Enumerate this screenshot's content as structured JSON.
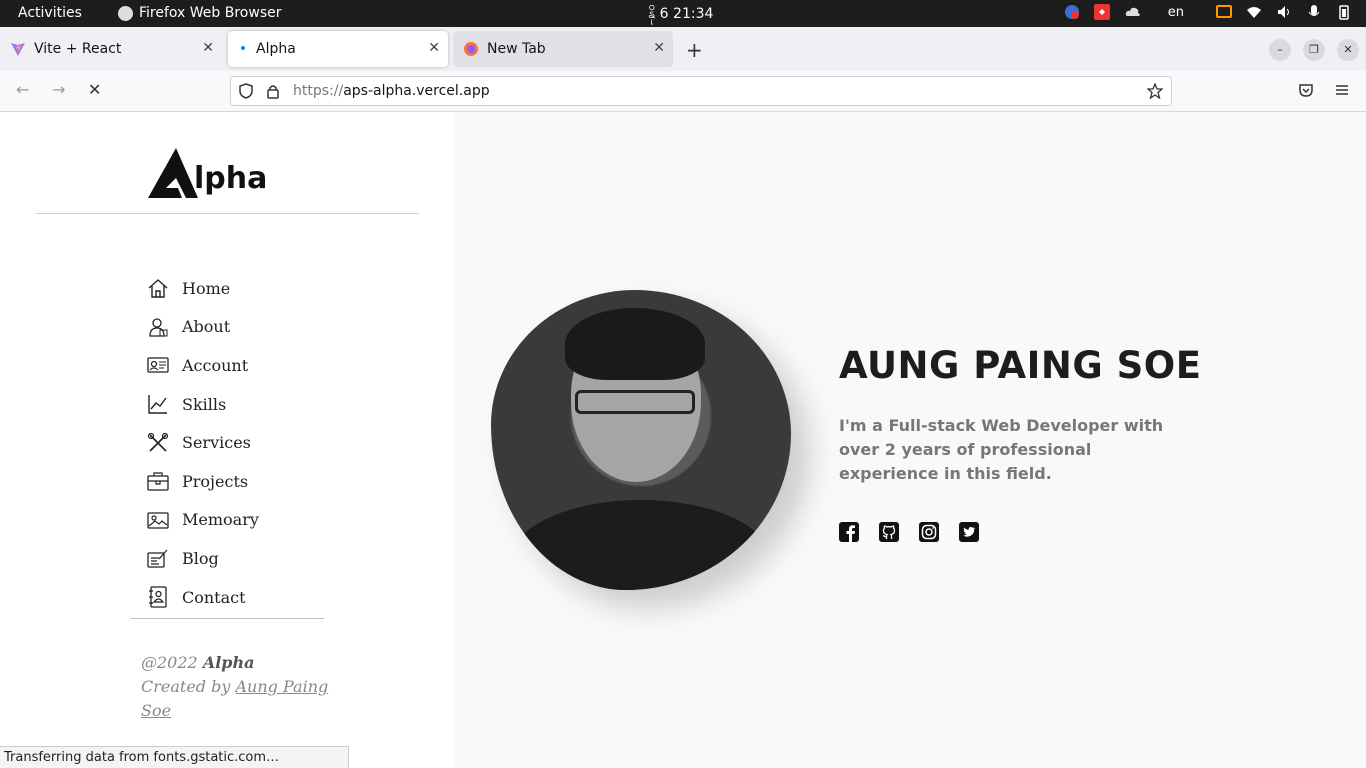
{
  "system": {
    "activities": "Activities",
    "app_name": "Firefox Web Browser",
    "clock": "နို 6  21:34",
    "lang": "en"
  },
  "tabs": [
    {
      "title": "Vite + React",
      "icon": "vite-icon"
    },
    {
      "title": "Alpha",
      "icon": "loading-dot-icon",
      "active": true
    },
    {
      "title": "New Tab",
      "icon": "firefox-icon"
    }
  ],
  "url": {
    "scheme": "https://",
    "host": "aps-alpha.vercel.app"
  },
  "sidebar": {
    "logo_text": "lpha",
    "menu": [
      {
        "label": "Home",
        "icon": "home-icon"
      },
      {
        "label": "About",
        "icon": "user-icon"
      },
      {
        "label": "Account",
        "icon": "id-card-icon"
      },
      {
        "label": "Skills",
        "icon": "chart-line-icon"
      },
      {
        "label": "Services",
        "icon": "tools-icon"
      },
      {
        "label": "Projects",
        "icon": "briefcase-icon"
      },
      {
        "label": "Memoary",
        "icon": "image-icon"
      },
      {
        "label": "Blog",
        "icon": "blog-icon"
      },
      {
        "label": "Contact",
        "icon": "contact-book-icon"
      }
    ],
    "footer": {
      "year": "@2022",
      "brand": "Alpha",
      "created_by": "Created by",
      "author": "Aung Paing Soe"
    }
  },
  "hero": {
    "name": "AUNG PAING SOE",
    "bio": "I'm a Full-stack Web Developer with over 2 years of professional experience in this field.",
    "socials": [
      "facebook-icon",
      "github-icon",
      "instagram-icon",
      "twitter-icon"
    ]
  },
  "status_text": "Transferring data from fonts.gstatic.com…",
  "colors": {
    "accent": "#1d1d1f",
    "sidebar_bg": "#ffffff",
    "main_bg": "#f8f9fb"
  }
}
